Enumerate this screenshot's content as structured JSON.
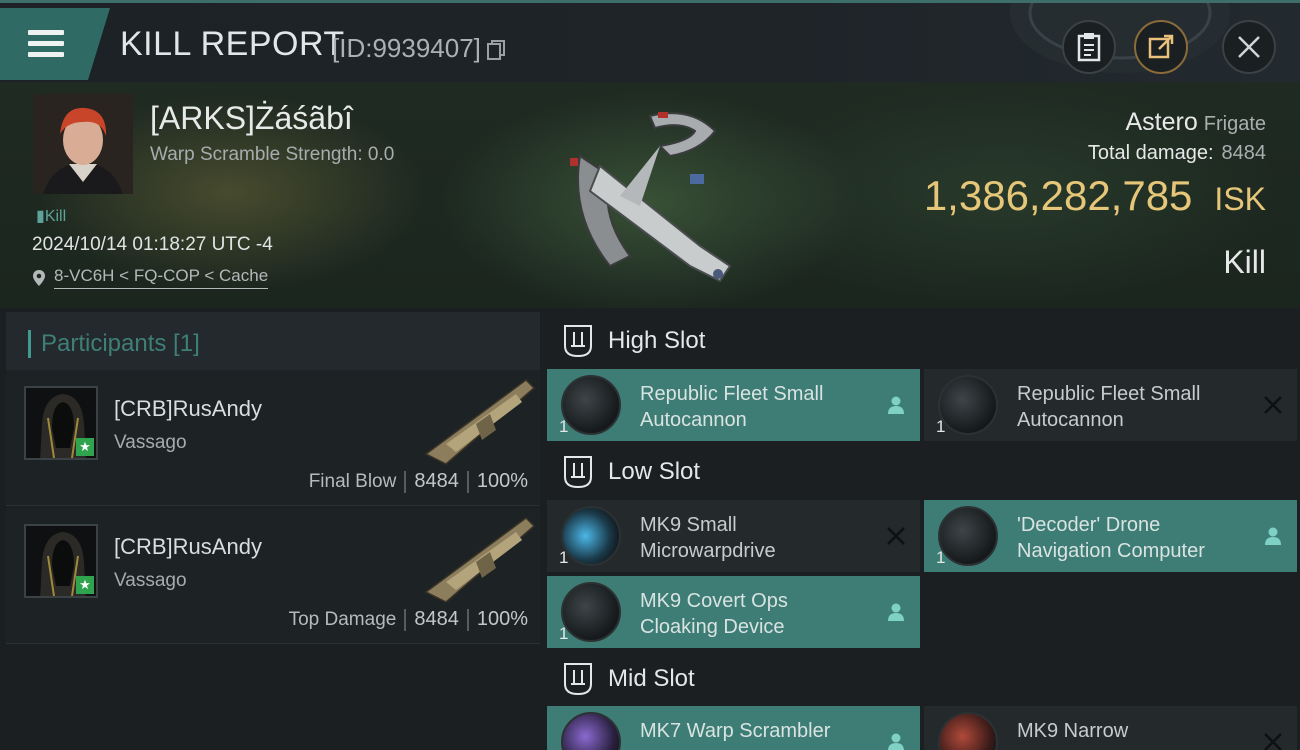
{
  "header": {
    "title": "KILL REPORT",
    "report_id": "[ID:9939407]"
  },
  "victim": {
    "name": "[ARKS]Żáśãbî",
    "warp_scramble": "Warp Scramble Strength: 0.0",
    "kill_tag": "Kill",
    "time": "2024/10/14 01:18:27 UTC -4",
    "location": "8-VC6H < FQ-COP < Cache",
    "ship_name": "Astero",
    "ship_class": "Frigate",
    "total_damage_label": "Total damage:",
    "total_damage_value": "8484",
    "isk_value": "1,386,282,785",
    "isk_unit": "ISK",
    "result_label": "Kill"
  },
  "participants": {
    "title": "Participants [1]",
    "rows": [
      {
        "name": "[CRB]RusAndy",
        "ship": "Vassago",
        "role": "Final Blow",
        "damage": "8484",
        "percent": "100%"
      },
      {
        "name": "[CRB]RusAndy",
        "ship": "Vassago",
        "role": "Top Damage",
        "damage": "8484",
        "percent": "100%"
      }
    ]
  },
  "fittings": {
    "high_slot": {
      "label": "High Slot",
      "modules": [
        {
          "qty": "1",
          "name": "Republic Fleet Small Autocannon",
          "status": "dropped"
        },
        {
          "qty": "1",
          "name": "Republic Fleet Small Autocannon",
          "status": "destroyed"
        }
      ]
    },
    "low_slot": {
      "label": "Low Slot",
      "modules": [
        {
          "qty": "1",
          "name": "MK9 Small Microwarpdrive",
          "status": "destroyed"
        },
        {
          "qty": "1",
          "name": "'Decoder' Drone Navigation Computer",
          "status": "dropped"
        },
        {
          "qty": "1",
          "name": "MK9 Covert Ops Cloaking Device",
          "status": "dropped"
        }
      ]
    },
    "mid_slot": {
      "label": "Mid Slot",
      "modules": [
        {
          "qty": "",
          "name": "MK7 Warp Scrambler",
          "status": "dropped"
        },
        {
          "qty": "",
          "name": "MK9 Narrow",
          "status": "destroyed"
        }
      ]
    }
  },
  "colors": {
    "accent": "#3d7d76",
    "isk": "#e6c679",
    "header_button": "#2f6a64"
  },
  "icons": {
    "menu": "hamburger-icon",
    "copy": "copy-icon",
    "clipboard": "clipboard-icon",
    "share": "share-icon",
    "close": "close-icon",
    "location": "location-pin-icon",
    "slot": "slot-icon",
    "dropped": "person-icon",
    "destroyed": "cross-icon"
  }
}
